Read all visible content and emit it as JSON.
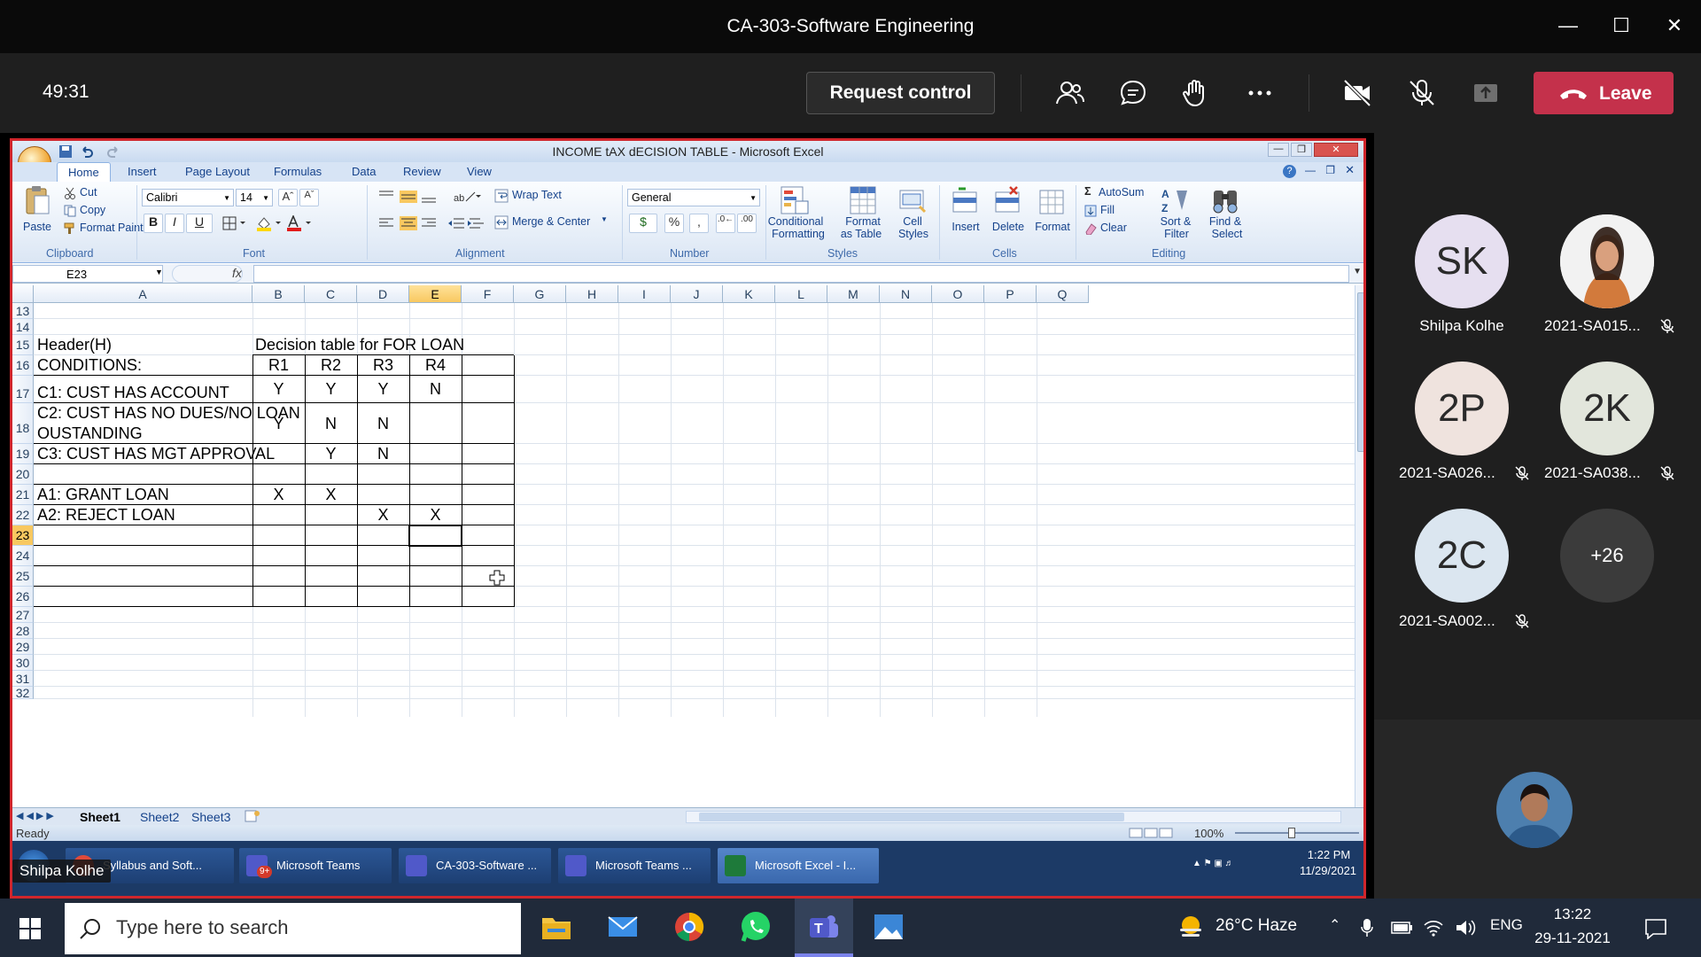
{
  "meeting": {
    "title": "CA-303-Software Engineering",
    "timer": "49:31",
    "request_control": "Request control",
    "leave": "Leave",
    "presenter_name": "Shilpa Kolhe"
  },
  "excel": {
    "window_title": "INCOME tAX dECISION  TABLE - Microsoft Excel",
    "tabs": [
      "Home",
      "Insert",
      "Page Layout",
      "Formulas",
      "Data",
      "Review",
      "View"
    ],
    "clipboard": {
      "paste": "Paste",
      "cut": "Cut",
      "copy": "Copy",
      "format_painter": "Format Painter",
      "label": "Clipboard"
    },
    "font": {
      "name": "Calibri",
      "size": "14",
      "label": "Font",
      "bold": "B",
      "italic": "I",
      "underline": "U"
    },
    "alignment": {
      "wrap_text": "Wrap Text",
      "merge_center": "Merge & Center",
      "label": "Alignment"
    },
    "number": {
      "format": "General",
      "currency": "$",
      "percent": "%",
      "comma": ",",
      "label": "Number"
    },
    "styles": {
      "conditional": "Conditional",
      "formatting": "Formatting",
      "format": "Format",
      "as_table": "as Table",
      "cell": "Cell",
      "cell_styles": "Styles",
      "label": "Styles"
    },
    "cells": {
      "insert": "Insert",
      "delete": "Delete",
      "format": "Format",
      "label": "Cells"
    },
    "editing": {
      "autosum": "AutoSum",
      "fill": "Fill",
      "clear": "Clear",
      "sort": "Sort &",
      "filter": "Filter",
      "find": "Find &",
      "select": "Select",
      "label": "Editing"
    },
    "name_box": "E23",
    "fx": "fx",
    "columns": [
      "A",
      "B",
      "C",
      "D",
      "E",
      "F",
      "G",
      "H",
      "I",
      "J",
      "K",
      "L",
      "M",
      "N",
      "O",
      "P",
      "Q"
    ],
    "rows": [
      "13",
      "14",
      "15",
      "16",
      "17",
      "18",
      "19",
      "20",
      "21",
      "22",
      "23",
      "24",
      "25",
      "26",
      "27",
      "28",
      "29",
      "30",
      "31",
      "32"
    ],
    "cells_data": {
      "header_label": "Header(H)",
      "table_title": "Decision table for FOR LOAN",
      "conditions_label": "CONDITIONS:",
      "rules": [
        "R1",
        "R2",
        "R3",
        "R4"
      ],
      "c1": {
        "label": "C1: CUST HAS ACCOUNT",
        "values": [
          "Y",
          "Y",
          "Y",
          "N"
        ]
      },
      "c2": {
        "label1": "C2: CUST HAS NO DUES/NO LOAN",
        "label2": "OUSTANDING",
        "values": [
          "Y",
          "N",
          "N"
        ]
      },
      "c3": {
        "label": "C3: CUST HAS MGT APPROVAL",
        "values": [
          "Y",
          "N"
        ]
      },
      "a1": {
        "label": "A1: GRANT LOAN",
        "values": [
          "X",
          "X"
        ]
      },
      "a2": {
        "label": "A2: REJECT LOAN",
        "values": [
          "X",
          "X"
        ]
      }
    },
    "sheets": [
      "Sheet1",
      "Sheet2",
      "Sheet3"
    ],
    "status": "Ready",
    "zoom": "100%",
    "taskbar_items": [
      "Syllabus and Soft...",
      "Microsoft Teams",
      "CA-303-Software ...",
      "Microsoft Teams ...",
      "Microsoft Excel - I..."
    ],
    "taskbar_badge": "9+",
    "time": "1:22 PM",
    "date": "11/29/2021"
  },
  "participants": [
    {
      "initials": "SK",
      "name": "Shilpa Kolhe",
      "color": "#e6dff0"
    },
    {
      "initials": "",
      "name": "2021-SA015...",
      "color": "#f1f1f1"
    },
    {
      "initials": "2P",
      "name": "2021-SA026...",
      "color": "#efe3de"
    },
    {
      "initials": "2K",
      "name": "2021-SA038...",
      "color": "#e2e6dc"
    },
    {
      "initials": "2C",
      "name": "2021-SA002...",
      "color": "#dbe6f0"
    },
    {
      "initials": "+26",
      "name": "",
      "color": "#3b3b3b"
    }
  ],
  "windows_taskbar": {
    "search_placeholder": "Type here to search",
    "weather": "26°C  Haze",
    "lang": "ENG",
    "time": "13:22",
    "date": "29-11-2021"
  }
}
